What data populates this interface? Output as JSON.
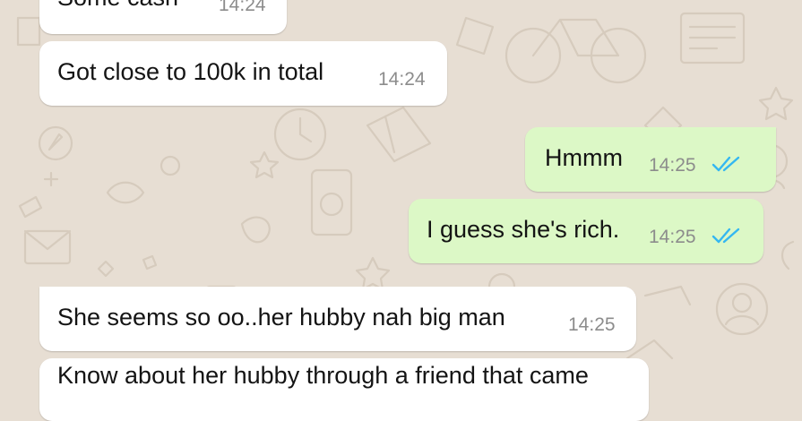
{
  "colors": {
    "wallpaper": "#e7ded3",
    "incoming_bubble": "#ffffff",
    "outgoing_bubble": "#dcf8c6",
    "read_ticks": "#34b7f1",
    "timestamp": "#8c8c8c"
  },
  "messages": [
    {
      "direction": "incoming",
      "text": "Some cash",
      "time": "14:24"
    },
    {
      "direction": "incoming",
      "text": "Got close to 100k in total",
      "time": "14:24"
    },
    {
      "direction": "outgoing",
      "text": "Hmmm",
      "time": "14:25",
      "status": "read-double-tick-icon"
    },
    {
      "direction": "outgoing",
      "text": "I guess she's rich.",
      "time": "14:25",
      "status": "read-double-tick-icon"
    },
    {
      "direction": "incoming",
      "text": "She seems so oo..her hubby nah big man",
      "time": "14:25"
    },
    {
      "direction": "incoming",
      "text": "Know about her hubby through a friend that came",
      "time": ""
    }
  ]
}
